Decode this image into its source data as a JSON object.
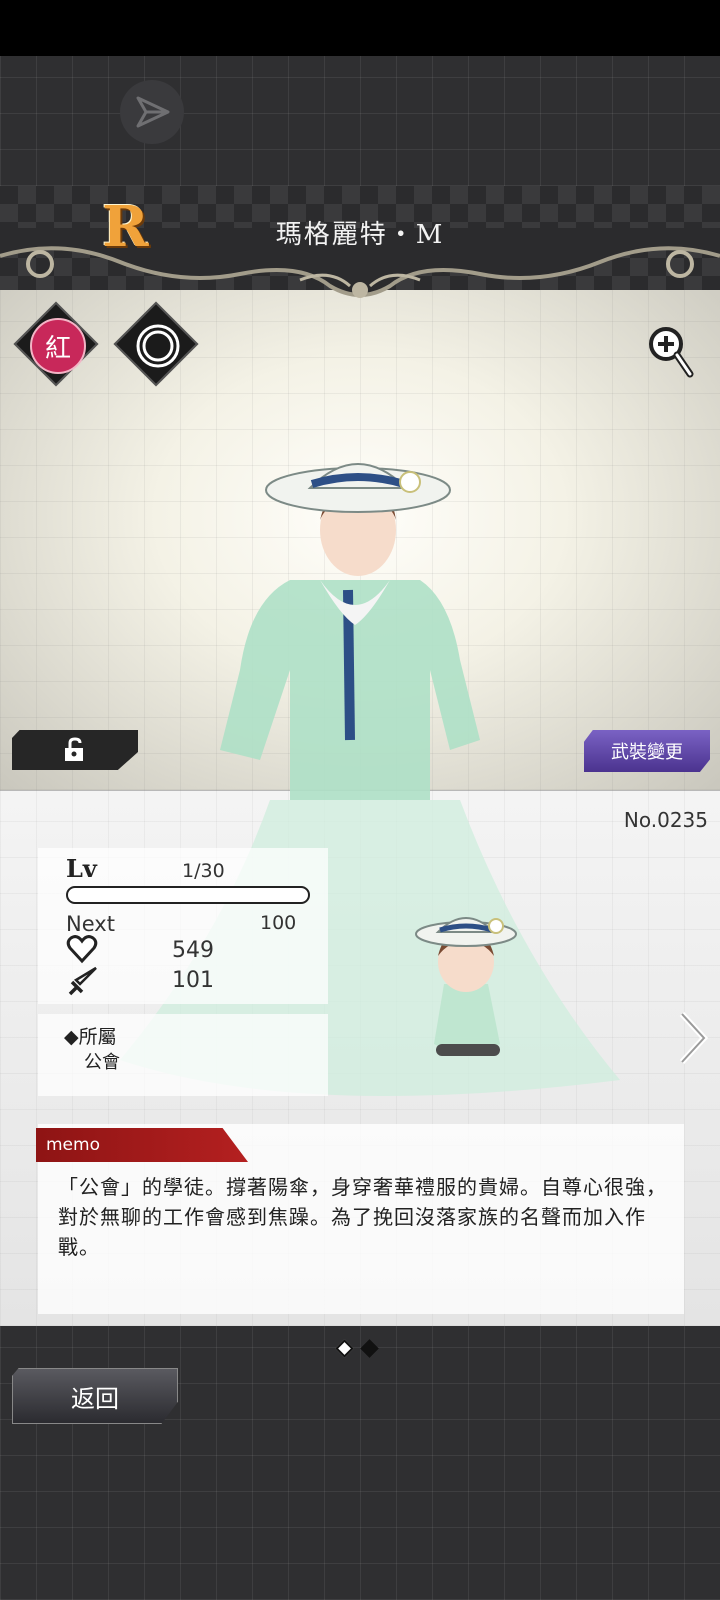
{
  "header": {
    "rarity": "R",
    "character_name": "瑪格麗特・M"
  },
  "badges": {
    "faction_label": "紅",
    "faction_color": "#c8285a",
    "type_icon": "concentric-rings-icon"
  },
  "buttons": {
    "equip_change_label": "武裝變更",
    "back_label": "返回",
    "lock_icon": "unlock-icon",
    "zoom_icon": "zoom-in-icon",
    "share_icon": "share-icon"
  },
  "card": {
    "number": "No.0235"
  },
  "stats": {
    "lv_label": "Lv",
    "level": "1/30",
    "level_progress": 0,
    "next_label": "Next",
    "next_value": "100",
    "hp": "549",
    "attack": "101"
  },
  "affiliation": {
    "label": "◆所屬",
    "value": "公會"
  },
  "memo": {
    "tab_label": "memo",
    "text": "「公會」的學徒。撐著陽傘，身穿奢華禮服的貴婦。自尊心很強，對於無聊的工作會感到焦躁。為了挽回沒落家族的名聲而加入作戰。"
  },
  "pagination": {
    "pages": 2,
    "current": 1
  },
  "colors": {
    "accent_purple": "#5a3fa0",
    "memo_red": "#a81c1c",
    "rarity_orange": "#f0a23a"
  }
}
